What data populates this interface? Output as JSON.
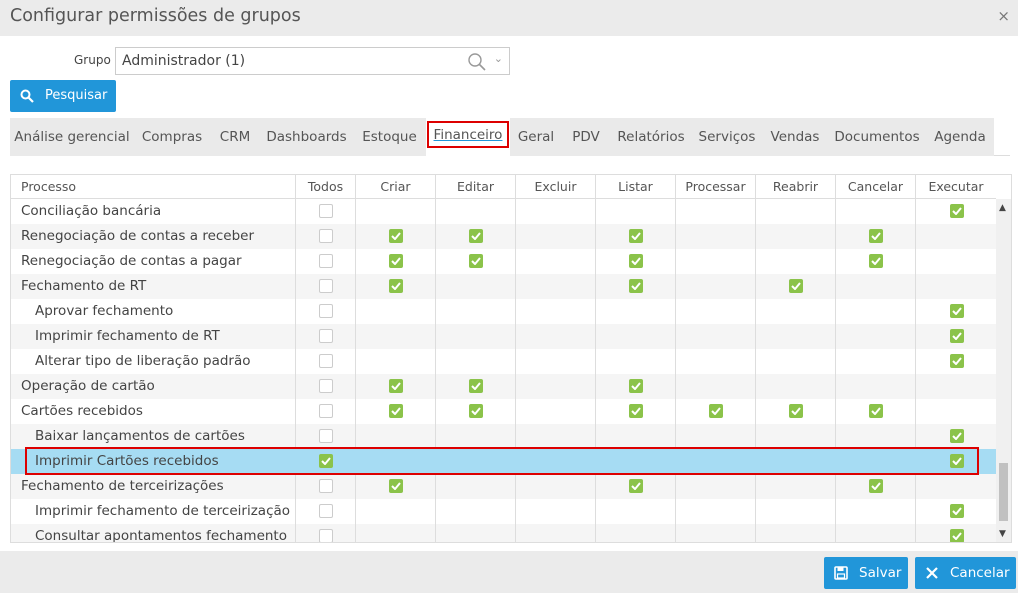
{
  "dialog": {
    "title": "Configurar permissões de grupos",
    "close": "×"
  },
  "grupo": {
    "label": "Grupo",
    "value": "Administrador (1)"
  },
  "search_button": {
    "label": "Pesquisar"
  },
  "tabs": [
    {
      "label": "Análise gerencial",
      "active": false
    },
    {
      "label": "Compras",
      "active": false
    },
    {
      "label": "CRM",
      "active": false
    },
    {
      "label": "Dashboards",
      "active": false
    },
    {
      "label": "Estoque",
      "active": false
    },
    {
      "label": "Financeiro",
      "active": true
    },
    {
      "label": "Geral",
      "active": false
    },
    {
      "label": "PDV",
      "active": false
    },
    {
      "label": "Relatórios",
      "active": false
    },
    {
      "label": "Serviços",
      "active": false
    },
    {
      "label": "Vendas",
      "active": false
    },
    {
      "label": "Documentos",
      "active": false
    },
    {
      "label": "Agenda",
      "active": false
    }
  ],
  "grid": {
    "columns": [
      "Processo",
      "Todos",
      "Criar",
      "Editar",
      "Excluir",
      "Listar",
      "Processar",
      "Reabrir",
      "Cancelar",
      "Executar"
    ],
    "rows": [
      {
        "name": "Conciliação bancária",
        "indent": 0,
        "selected": false,
        "perms": [
          null,
          false,
          false,
          false,
          false,
          false,
          false,
          false,
          true
        ]
      },
      {
        "name": "Renegociação de contas a receber",
        "indent": 0,
        "selected": false,
        "perms": [
          null,
          true,
          true,
          false,
          true,
          false,
          false,
          true,
          false
        ]
      },
      {
        "name": "Renegociação de contas a pagar",
        "indent": 0,
        "selected": false,
        "perms": [
          null,
          true,
          true,
          false,
          true,
          false,
          false,
          true,
          false
        ]
      },
      {
        "name": "Fechamento de RT",
        "indent": 0,
        "selected": false,
        "perms": [
          null,
          true,
          false,
          false,
          true,
          false,
          true,
          false,
          false
        ]
      },
      {
        "name": "Aprovar fechamento",
        "indent": 1,
        "selected": false,
        "perms": [
          null,
          false,
          false,
          false,
          false,
          false,
          false,
          false,
          true
        ]
      },
      {
        "name": "Imprimir fechamento de RT",
        "indent": 1,
        "selected": false,
        "perms": [
          null,
          false,
          false,
          false,
          false,
          false,
          false,
          false,
          true
        ]
      },
      {
        "name": "Alterar tipo de liberação padrão",
        "indent": 1,
        "selected": false,
        "perms": [
          null,
          false,
          false,
          false,
          false,
          false,
          false,
          false,
          true
        ]
      },
      {
        "name": "Operação de cartão",
        "indent": 0,
        "selected": false,
        "perms": [
          null,
          true,
          true,
          false,
          true,
          false,
          false,
          false,
          false
        ]
      },
      {
        "name": "Cartões recebidos",
        "indent": 0,
        "selected": false,
        "perms": [
          null,
          true,
          true,
          false,
          true,
          true,
          true,
          true,
          false
        ]
      },
      {
        "name": "Baixar lançamentos de cartões",
        "indent": 1,
        "selected": false,
        "perms": [
          null,
          false,
          false,
          false,
          false,
          false,
          false,
          false,
          true
        ]
      },
      {
        "name": "Imprimir Cartões recebidos",
        "indent": 1,
        "selected": true,
        "perms": [
          true,
          false,
          false,
          false,
          false,
          false,
          false,
          false,
          true
        ]
      },
      {
        "name": "Fechamento de terceirizações",
        "indent": 0,
        "selected": false,
        "perms": [
          null,
          true,
          false,
          false,
          true,
          false,
          false,
          true,
          false
        ]
      },
      {
        "name": "Imprimir fechamento de terceirização",
        "indent": 1,
        "selected": false,
        "perms": [
          null,
          false,
          false,
          false,
          false,
          false,
          false,
          false,
          true
        ]
      },
      {
        "name": "Consultar apontamentos fechamento de te",
        "indent": 1,
        "selected": false,
        "perms": [
          null,
          false,
          false,
          false,
          false,
          false,
          false,
          false,
          true
        ]
      }
    ]
  },
  "footer": {
    "save": "Salvar",
    "cancel": "Cancelar"
  },
  "colors": {
    "accent": "#2196d9",
    "check": "#8bc34a",
    "selected_row": "#a6dcf3",
    "highlight": "#dd0000"
  }
}
